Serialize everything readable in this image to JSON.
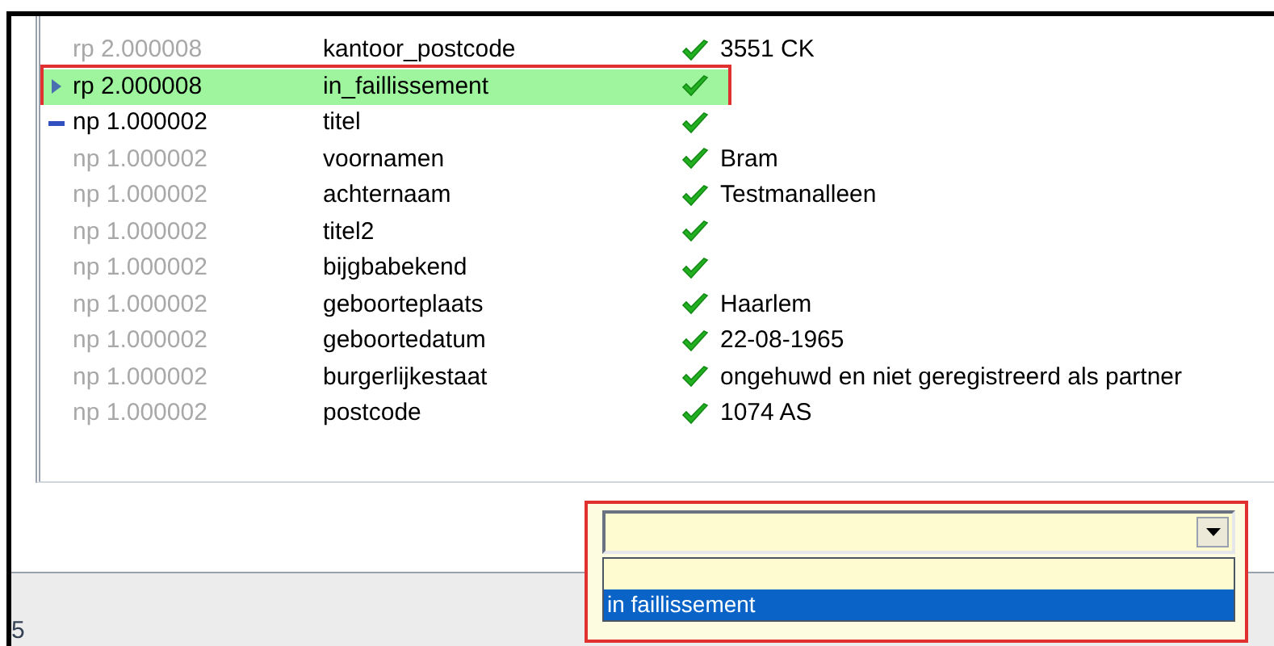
{
  "rows": [
    {
      "code": "rp 2.000008",
      "name": "kantoor_postcode",
      "checked": true,
      "value": "3551 CK",
      "dimmed": true,
      "kind": "plain",
      "selected": false,
      "annotated": false
    },
    {
      "code": "rp 2.000008",
      "name": "in_faillissement",
      "checked": true,
      "dimmed": false,
      "kind": "pointer",
      "selected": true,
      "annotated": true
    },
    {
      "code": "np 1.000002",
      "name": "titel",
      "checked": true,
      "dimmed": false,
      "kind": "dash",
      "selected": false,
      "annotated": false
    },
    {
      "code": "np 1.000002",
      "name": "voornamen",
      "checked": true,
      "value": "Bram",
      "dimmed": true,
      "kind": "plain",
      "selected": false,
      "annotated": false
    },
    {
      "code": "np 1.000002",
      "name": "achternaam",
      "checked": true,
      "value": "Testmanalleen",
      "dimmed": true,
      "kind": "plain",
      "selected": false,
      "annotated": false
    },
    {
      "code": "np 1.000002",
      "name": "titel2",
      "checked": true,
      "dimmed": true,
      "kind": "plain",
      "selected": false,
      "annotated": false
    },
    {
      "code": "np 1.000002",
      "name": "bijgbabekend",
      "checked": true,
      "dimmed": true,
      "kind": "plain",
      "selected": false,
      "annotated": false
    },
    {
      "code": "np 1.000002",
      "name": "geboorteplaats",
      "checked": true,
      "value": "Haarlem",
      "dimmed": true,
      "kind": "plain",
      "selected": false,
      "annotated": false
    },
    {
      "code": "np 1.000002",
      "name": "geboortedatum",
      "checked": true,
      "value": "22-08-1965",
      "dimmed": true,
      "kind": "plain",
      "selected": false,
      "annotated": false
    },
    {
      "code": "np 1.000002",
      "name": "burgerlijkestaat",
      "checked": true,
      "value": "ongehuwd en niet geregistreerd als partner",
      "dimmed": true,
      "kind": "plain",
      "selected": false,
      "annotated": false
    },
    {
      "code": "np 1.000002",
      "name": "postcode",
      "checked": true,
      "value": "1074 AS",
      "dimmed": true,
      "kind": "plain",
      "selected": false,
      "annotated": false
    }
  ],
  "dropdown": {
    "annotated": true,
    "expanded": true,
    "options": [
      {
        "selected": false
      },
      {
        "label": "in faillissement",
        "selected": true
      }
    ]
  },
  "status_bar": {
    "text": "5"
  }
}
